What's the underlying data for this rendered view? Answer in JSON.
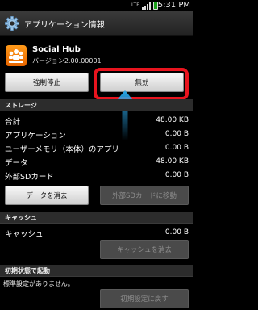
{
  "status_bar": {
    "network": "LTE",
    "time": "5:31 PM"
  },
  "header": {
    "title": "アプリケーション情報",
    "icon": "gear-icon"
  },
  "app": {
    "name": "Social Hub",
    "version": "バージョン2.00.00001",
    "icon": "social-hub-icon"
  },
  "actions": {
    "force_stop": "強制停止",
    "disable": "無効"
  },
  "storage": {
    "header": "ストレージ",
    "rows": [
      {
        "label": "合計",
        "value": "48.00 KB"
      },
      {
        "label": "アプリケーション",
        "value": "0.00 B"
      },
      {
        "label": "ユーザーメモリ（本体）のアプリ",
        "value": "0.00 B"
      },
      {
        "label": "データ",
        "value": "48.00 KB"
      },
      {
        "label": "外部SDカード",
        "value": "0.00 B"
      }
    ],
    "clear_data": "データを消去",
    "move_to_sd": "外部SDカードに移動"
  },
  "cache": {
    "header": "キャッシュ",
    "label": "キャッシュ",
    "value": "0.00 B",
    "clear_cache": "キャッシュを消去"
  },
  "launch_default": {
    "header": "初期状態で起動",
    "note": "標準設定がありません。",
    "clear_defaults": "初期設定に戻す"
  },
  "colors": {
    "highlight": "#e8141e",
    "arrow": "#2aa6e8",
    "app_icon": "#f07a00"
  }
}
